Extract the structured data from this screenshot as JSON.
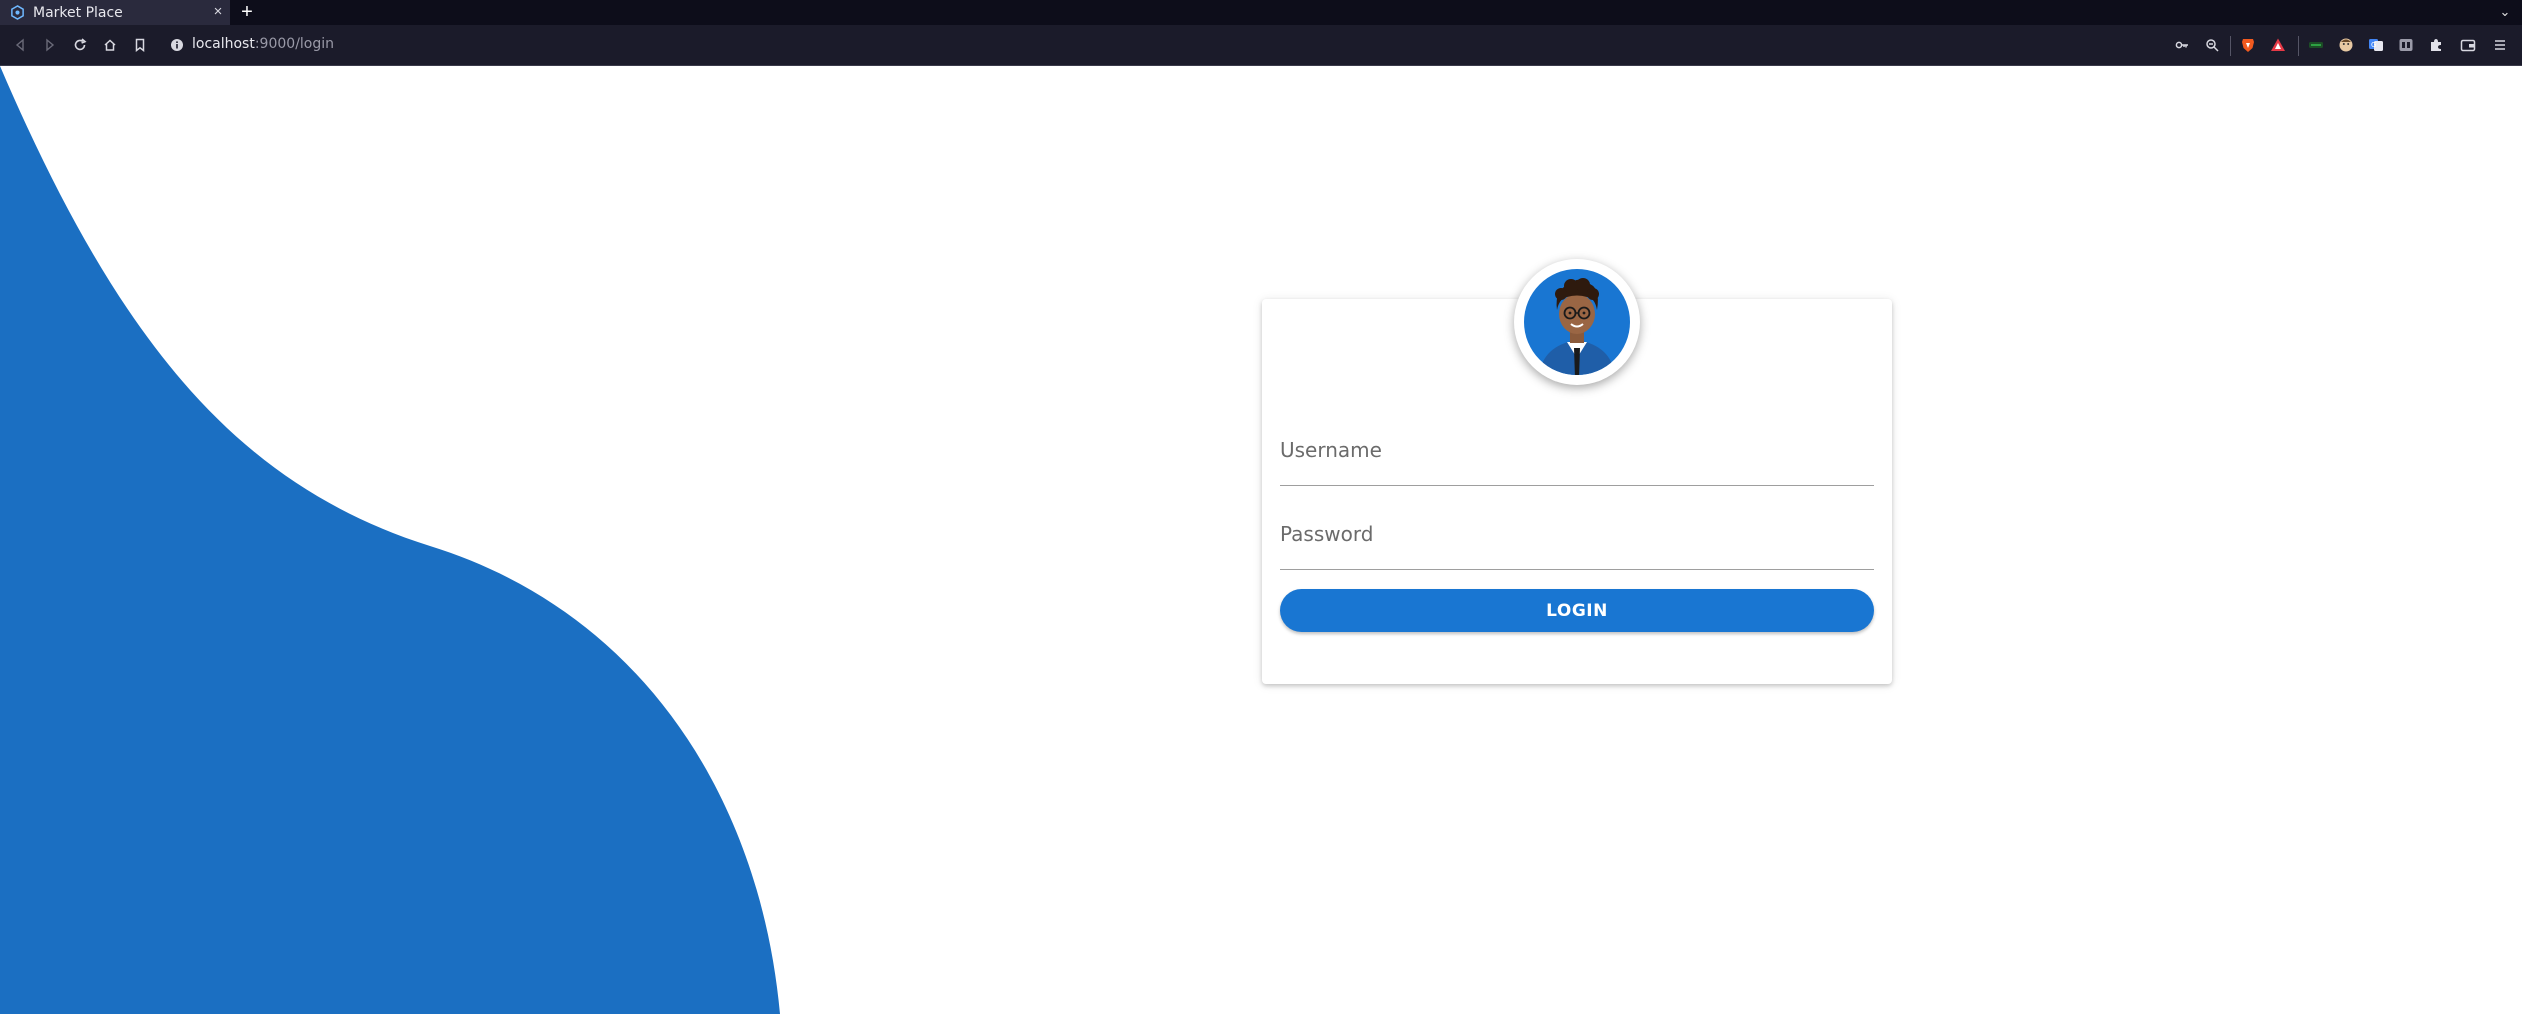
{
  "browser": {
    "tab_title": "Market Place",
    "tab_close": "×",
    "new_tab": "+",
    "tabs_menu": "⌄",
    "url_host": "localhost",
    "url_rest": ":9000/login",
    "toolbar_icons": [
      "back-icon",
      "forward-icon",
      "reload-icon",
      "home-icon",
      "bookmark-icon"
    ],
    "extension_icons": [
      "key-icon",
      "zoom-icon",
      "brave-shield-icon",
      "brave-rewards-icon",
      "extension-green-icon",
      "extension-face-icon",
      "extension-translate-icon",
      "extension-grid-icon",
      "extensions-puzzle-icon",
      "wallet-icon",
      "menu-icon"
    ]
  },
  "login": {
    "username_label": "Username",
    "password_label": "Password",
    "login_button": "LOGIN",
    "avatar_icon": "user-avatar-icon"
  },
  "colors": {
    "primary": "#1976d2",
    "blob": "#1b6fc2",
    "chrome_tabbar": "#0d0d1a",
    "chrome_toolbar": "#1b1b2a"
  }
}
